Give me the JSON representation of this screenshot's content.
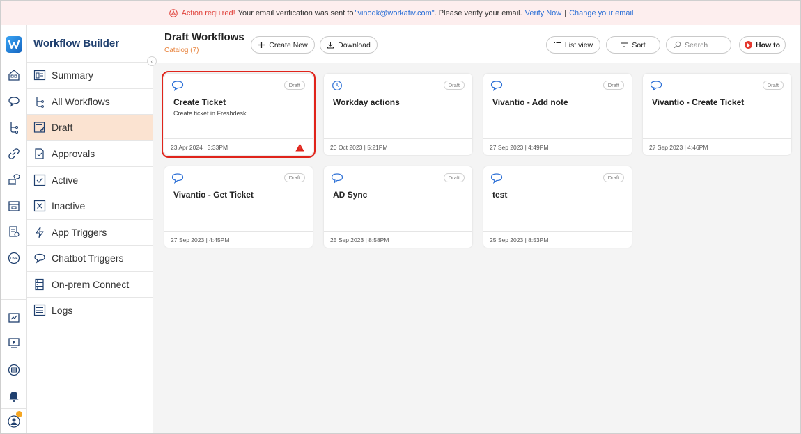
{
  "banner": {
    "required": "Action required!",
    "message_before": "Your email verification was sent to",
    "email": "\"vinodk@workativ.com\"",
    "message_after": ". Please verify your email.",
    "verify_link": "Verify Now",
    "separator": "|",
    "change_link": "Change your email",
    "colors": {
      "background": "#fdeeee",
      "required": "#e0433c",
      "link": "#2b6fd6"
    }
  },
  "app": {
    "title": "Workflow Builder"
  },
  "rail": {
    "icons": [
      "home-icon",
      "chat-icon",
      "workflow-icon",
      "link-icon",
      "agent-icon",
      "inbox-icon",
      "clipboard-icon",
      "live-icon",
      "chart-icon",
      "video-icon",
      "marketplace-icon",
      "bell-icon",
      "user-icon"
    ]
  },
  "sidebar": {
    "items": [
      {
        "label": "Summary",
        "icon": "summary-icon"
      },
      {
        "label": "All Workflows",
        "icon": "workflow-icon"
      },
      {
        "label": "Draft",
        "icon": "draft-icon",
        "active": true
      },
      {
        "label": "Approvals",
        "icon": "approvals-icon"
      },
      {
        "label": "Active",
        "icon": "active-check-icon"
      },
      {
        "label": "Inactive",
        "icon": "inactive-x-icon"
      },
      {
        "label": "App Triggers",
        "icon": "lightning-icon"
      },
      {
        "label": "Chatbot Triggers",
        "icon": "chat-icon"
      },
      {
        "label": "On-prem Connect",
        "icon": "onprem-icon"
      },
      {
        "label": "Logs",
        "icon": "logs-icon"
      }
    ],
    "active_color": "#fbe3d1"
  },
  "header": {
    "title": "Draft Workflows",
    "catalog": "Catalog (7)",
    "create_new": "Create New",
    "download": "Download",
    "list_view": "List view",
    "sort": "Sort",
    "search_placeholder": "Search",
    "how_to": "How to"
  },
  "cards": [
    {
      "title": "Create Ticket",
      "subtitle": "Create ticket in Freshdesk",
      "badge": "Draft",
      "date": "23 Apr 2024 | 3:33PM",
      "icon": "chat-icon",
      "alert": true,
      "selected": true
    },
    {
      "title": "Workday actions",
      "subtitle": "",
      "badge": "Draft",
      "date": "20 Oct 2023 | 5:21PM",
      "icon": "clock-icon"
    },
    {
      "title": "Vivantio - Add note",
      "subtitle": "",
      "badge": "Draft",
      "date": "27 Sep 2023 | 4:49PM",
      "icon": "chat-icon"
    },
    {
      "title": "Vivantio - Create Ticket",
      "subtitle": "",
      "badge": "Draft",
      "date": "27 Sep 2023 | 4:46PM",
      "icon": "chat-icon"
    },
    {
      "title": "Vivantio - Get Ticket",
      "subtitle": "",
      "badge": "Draft",
      "date": "27 Sep 2023 | 4:45PM",
      "icon": "chat-icon"
    },
    {
      "title": "AD Sync",
      "subtitle": "",
      "badge": "Draft",
      "date": "25 Sep 2023 | 8:58PM",
      "icon": "chat-icon"
    },
    {
      "title": "test",
      "subtitle": "",
      "badge": "Draft",
      "date": "25 Sep 2023 | 8:53PM",
      "icon": "chat-icon"
    }
  ],
  "colors": {
    "accent": "#e8823b",
    "alert": "#e0241b",
    "title_blue": "#1f3f6e",
    "icon_blue": "#2b6fd6"
  }
}
